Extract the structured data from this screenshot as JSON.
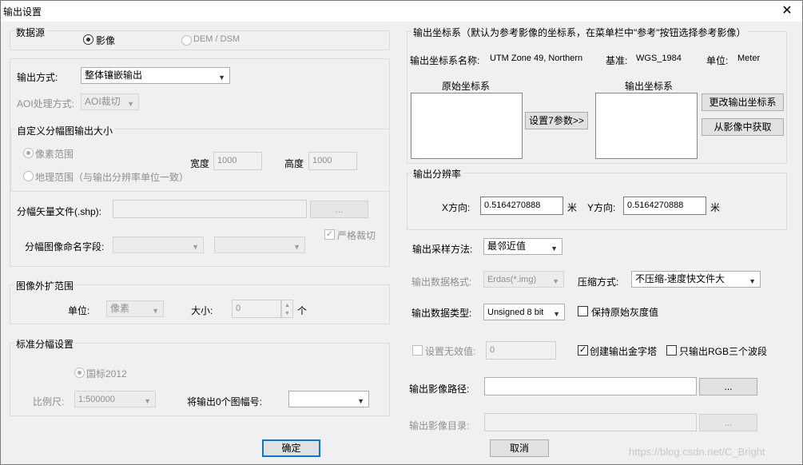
{
  "window": {
    "title": "输出设置",
    "close_icon": "✕"
  },
  "data_source": {
    "title": "数据源",
    "option_image": "影像",
    "option_dem": "DEM / DSM"
  },
  "output_mode": {
    "label": "输出方式:",
    "value": "整体镶嵌输出",
    "aoi_label": "AOI处理方式:",
    "aoi_value": "AOI裁切"
  },
  "tile_size": {
    "title": "自定义分幅图输出大小",
    "pixel_range": "像素范围",
    "geo_range": "地理范围（与输出分辨率单位一致）",
    "width_label": "宽度",
    "width_value": "1000",
    "height_label": "高度",
    "height_value": "1000"
  },
  "tile_vector": {
    "label": "分幅矢量文件(.shp):",
    "browse": "...",
    "strict_crop": "严格裁切",
    "name_field_label": "分幅图像命名字段:"
  },
  "expand": {
    "title": "图像外扩范围",
    "unit_label": "单位:",
    "unit_value": "像素",
    "size_label": "大小:",
    "size_value": "0",
    "size_unit": "个"
  },
  "standard_tile": {
    "title": "标准分幅设置",
    "gb2012": "国标2012",
    "scale_label": "比例尺:",
    "scale_value": "1:500000",
    "tile_no_label": "将输出0个图幅号:"
  },
  "crs": {
    "title": "输出坐标系（默认为参考影像的坐标系，在菜单栏中\"参考\"按钮选择参考影像）",
    "name_label": "输出坐标系名称:",
    "name_value": "UTM Zone 49, Northern",
    "datum_label": "基准:",
    "datum_value": "WGS_1984",
    "unit_label": "单位:",
    "unit_value": "Meter",
    "source_title": "原始坐标系",
    "target_title": "输出坐标系",
    "seven_param": "设置7参数>>",
    "change_btn": "更改输出坐标系",
    "from_image_btn": "从影像中获取"
  },
  "resolution": {
    "title": "输出分辨率",
    "x_label": "X方向:",
    "x_value": "0.5164270888",
    "x_unit": "米",
    "y_label": "Y方向:",
    "y_value": "0.5164270888",
    "y_unit": "米"
  },
  "output_opts": {
    "resample_label": "输出采样方法:",
    "resample_value": "最邻近值",
    "format_label": "输出数据格式:",
    "format_value": "Erdas(*.img)",
    "compress_label": "压缩方式:",
    "compress_value": "不压缩-速度快文件大",
    "dtype_label": "输出数据类型:",
    "dtype_value": "Unsigned 8 bit",
    "keep_gray": "保持原始灰度值",
    "nodata_label": "设置无效值:",
    "nodata_value": "0",
    "pyramid": "创建输出金字塔",
    "rgb_only": "只输出RGB三个波段",
    "path_label": "输出影像路径:",
    "path_browse": "...",
    "dir_label": "输出影像目录:",
    "dir_browse": "..."
  },
  "footer": {
    "ok": "确定",
    "cancel": "取消",
    "watermark": "https://blog.csdn.net/C_Bright"
  }
}
